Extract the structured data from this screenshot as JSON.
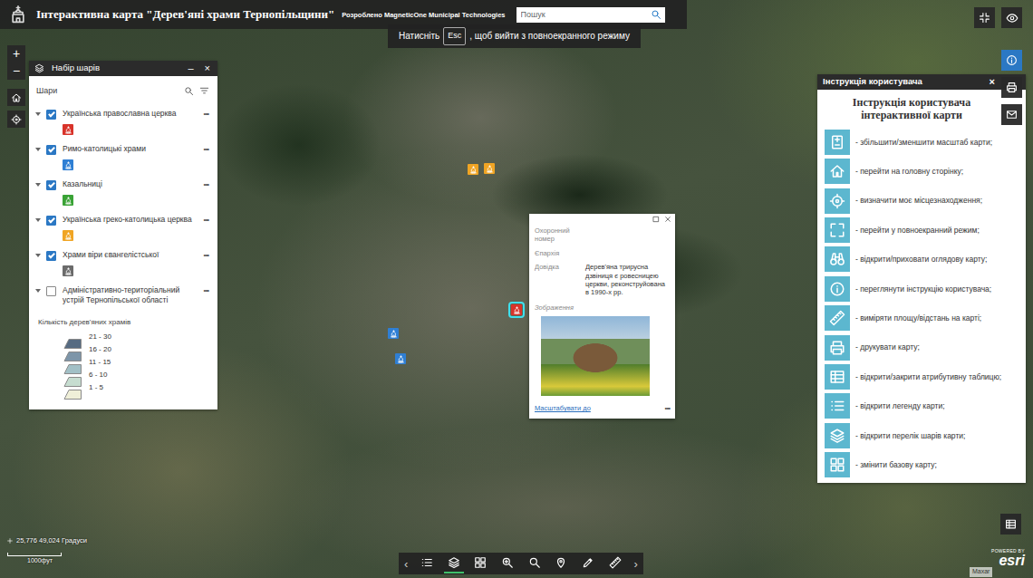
{
  "header": {
    "title": "Інтерактивна карта \"Дерев'яні храми Тернопільщини\"",
    "developer": "Розроблено MagneticOne Municipal Technologies",
    "search": {
      "placeholder": "Пошук"
    }
  },
  "fullscreen_notice": {
    "before": "Натисніть",
    "key": "Esc",
    "after": ", щоб вийти з повноекранного режиму"
  },
  "zoom": {
    "in": "+",
    "out": "−"
  },
  "layer_panel": {
    "title": "Набір шарів",
    "minimize": "–",
    "close": "×",
    "section": "Шари",
    "layers": [
      {
        "kind": "points",
        "label": "Українська православна церква",
        "checked": true,
        "expanded": true,
        "color": "#d8332a",
        "menu": "•••"
      },
      {
        "kind": "points",
        "label": "Римо-католицькі храми",
        "checked": true,
        "expanded": true,
        "color": "#2f7fd4",
        "menu": "•••"
      },
      {
        "kind": "points",
        "label": "Казальниці",
        "checked": true,
        "expanded": true,
        "color": "#3aa336",
        "menu": "•••"
      },
      {
        "kind": "points",
        "label": "Українська греко-католицька церква",
        "checked": true,
        "expanded": true,
        "color": "#f0a524",
        "menu": "•••"
      },
      {
        "kind": "points",
        "label": "Храми віри євангелістської",
        "checked": true,
        "expanded": true,
        "color": "#6b6b6b",
        "menu": "•••"
      },
      {
        "kind": "choropleth",
        "label": "Адміністративно-територіальний устрій Тернопільської області",
        "checked": false,
        "expanded": true,
        "menu": "•••",
        "legend": {
          "title": "Кількість дерев'яних храмів",
          "classes": [
            {
              "label": "21 - 30",
              "color": "#566b82"
            },
            {
              "label": "16 - 20",
              "color": "#7d95a9"
            },
            {
              "label": "11 - 15",
              "color": "#a2c0c6"
            },
            {
              "label": "6 - 10",
              "color": "#c6ddd0"
            },
            {
              "label": "1 - 5",
              "color": "#efefd8"
            }
          ]
        }
      }
    ]
  },
  "map_markers": [
    {
      "color": "#f0a524",
      "selected": false
    },
    {
      "color": "#f0a524",
      "selected": false
    },
    {
      "color": "#d8332a",
      "selected": true
    },
    {
      "color": "#2f7fd4",
      "selected": false
    },
    {
      "color": "#2f7fd4",
      "selected": false
    }
  ],
  "popup": {
    "fields": [
      {
        "label": "Охоронний номер"
      },
      {
        "label": "Єпархія"
      },
      {
        "label": "Довідка",
        "value": "Дерев'яна трирусна дзвіниця є ровесницею церкви, реконструйована в 1990-х рр."
      }
    ],
    "image_label": "Зображення",
    "zoom_link": "Масштабувати до",
    "menu": "•••"
  },
  "instructions": {
    "title": "Інструкція користувача",
    "close": "×",
    "heading": "Інструкція користувача інтерактивної карти",
    "items": [
      "- збільшити/зменшити масштаб карти;",
      "- перейти на головну сторінку;",
      "- визначити моє місцезнаходження;",
      "- перейти у повноекранний режим;",
      "- відкрити/приховати оглядову карту;",
      "- переглянути інструкцію користувача;",
      "- виміряти площу/відстань на карті;",
      "- друкувати карту;",
      "- відкрити/закрити атрибутивну таблицю;",
      "- відкрити легенду карти;",
      "- відкрити перелік шарів карти;",
      "- змінити базову карту;"
    ]
  },
  "side_buttons": [
    {
      "selected": true
    },
    {
      "selected": false
    },
    {
      "selected": false
    }
  ],
  "toolbar": {
    "prev": "‹",
    "next": "›",
    "tools": [
      {
        "selected": false
      },
      {
        "selected": true
      },
      {
        "selected": false
      },
      {
        "selected": false
      },
      {
        "selected": false
      },
      {
        "selected": false
      },
      {
        "selected": false
      },
      {
        "selected": false
      }
    ]
  },
  "status": {
    "coords": "25,776 49,024 Градуси",
    "scale": "1000фут"
  },
  "attribution": {
    "provider": "Maxar",
    "powered_by": "POWERED BY",
    "brand": "esri"
  }
}
